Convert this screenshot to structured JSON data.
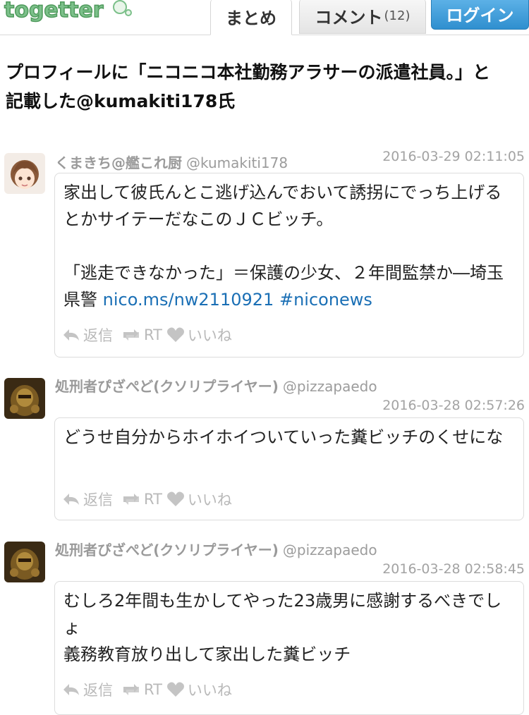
{
  "header": {
    "logo_text": "togetter",
    "tabs": [
      {
        "label": "まとめ",
        "count": ""
      },
      {
        "label": "コメント",
        "count": "(12)"
      }
    ],
    "login_label": "ログイン"
  },
  "title": "プロフィールに「ニコニコ本社勤務アラサーの派遣社員。」と記載した@kumakiti178氏",
  "actions": {
    "reply": "返信",
    "retweet": "RT",
    "like": "いいね"
  },
  "tweets": [
    {
      "name": "くまきち@艦これ厨",
      "handle": "@kumakiti178",
      "date": "2016-03-29 02:11:05",
      "text1": "家出して彼氏んとこ逃げ込んでおいて誘拐にでっち上げるとかサイテーだなこのＪＣビッチ。\n\n「逃走できなかった」＝保護の少女、２年間監禁か―埼玉県警 ",
      "link": "nico.ms/nw2110921",
      "hashtag": "#niconews"
    },
    {
      "name": "処刑者ぴざぺど(クソリプライヤー)",
      "handle": "@pizzapaedo",
      "date": "2016-03-28 02:57:26",
      "text1": "どうせ自分からホイホイついていった糞ビッチのくせにな"
    },
    {
      "name": "処刑者ぴざぺど(クソリプライヤー)",
      "handle": "@pizzapaedo",
      "date": "2016-03-28 02:58:45",
      "text1": "むしろ2年間も生かしてやった23歳男に感謝するべきでしょ\n義務教育放り出して家出した糞ビッチ"
    }
  ]
}
